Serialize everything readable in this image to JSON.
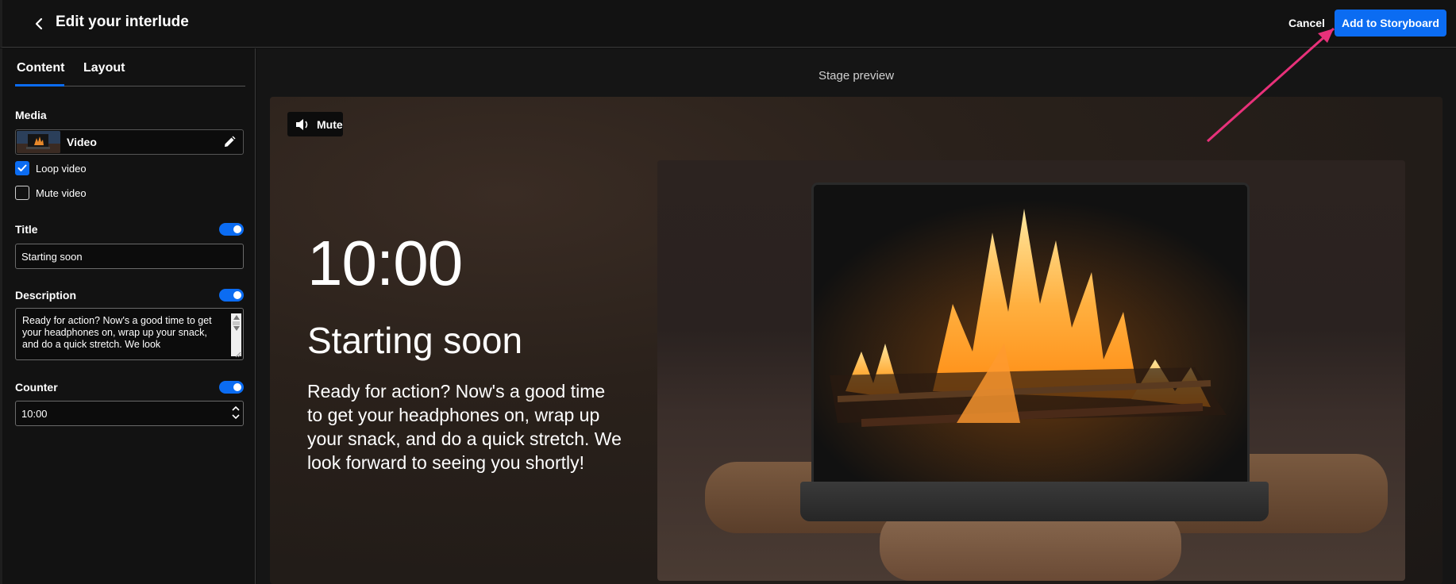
{
  "header": {
    "title": "Edit your interlude",
    "cancel_label": "Cancel",
    "add_label": "Add to Storyboard"
  },
  "sidebar": {
    "tabs": [
      {
        "label": "Content",
        "active": true
      },
      {
        "label": "Layout",
        "active": false
      }
    ],
    "media": {
      "label": "Media",
      "value": "Video",
      "loop_label": "Loop video",
      "loop_checked": true,
      "mute_label": "Mute video",
      "mute_checked": false
    },
    "title_section": {
      "label": "Title",
      "enabled": true,
      "value": "Starting soon"
    },
    "description_section": {
      "label": "Description",
      "enabled": true,
      "value": "Ready for action? Now's a good time to get your headphones on, wrap up your snack, and do a quick stretch. We look"
    },
    "counter_section": {
      "label": "Counter",
      "enabled": true,
      "value": "10:00"
    }
  },
  "preview": {
    "stage_label": "Stage preview",
    "mute_label": "Mute",
    "counter": "10:00",
    "title": "Starting soon",
    "description": "Ready for action? Now's a good time to get your headphones on, wrap up your snack, and do a quick stretch. We look forward to seeing you shortly!"
  },
  "colors": {
    "accent": "#0b6cf2",
    "annotation_arrow": "#e8317a"
  }
}
